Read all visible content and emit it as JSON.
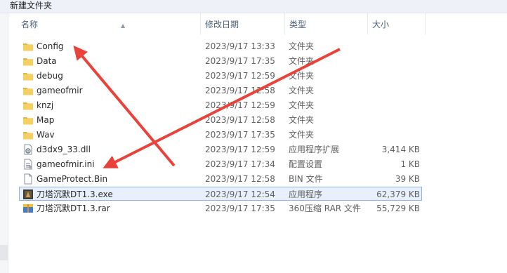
{
  "window": {
    "title": "新建文件夹"
  },
  "columns": {
    "name": "名称",
    "date": "修改日期",
    "type": "类型",
    "size": "大小"
  },
  "files": [
    {
      "name": "Config",
      "date": "2023/9/17 13:33",
      "type": "文件夹",
      "size": "",
      "icon": "folder-icon"
    },
    {
      "name": "Data",
      "date": "2023/9/17 17:35",
      "type": "文件夹",
      "size": "",
      "icon": "folder-icon"
    },
    {
      "name": "debug",
      "date": "2023/9/17 12:59",
      "type": "文件夹",
      "size": "",
      "icon": "folder-icon"
    },
    {
      "name": "gameofmir",
      "date": "2023/9/17 12:58",
      "type": "文件夹",
      "size": "",
      "icon": "folder-icon"
    },
    {
      "name": "knzj",
      "date": "2023/9/17 12:59",
      "type": "文件夹",
      "size": "",
      "icon": "folder-icon"
    },
    {
      "name": "Map",
      "date": "2023/9/17 12:58",
      "type": "文件夹",
      "size": "",
      "icon": "folder-icon"
    },
    {
      "name": "Wav",
      "date": "2023/9/17 17:35",
      "type": "文件夹",
      "size": "",
      "icon": "folder-icon"
    },
    {
      "name": "d3dx9_33.dll",
      "date": "2023/9/17 12:59",
      "type": "应用程序扩展",
      "size": "3,414 KB",
      "icon": "dll-file-icon"
    },
    {
      "name": "gameofmir.ini",
      "date": "2023/9/17 17:34",
      "type": "配置设置",
      "size": "1 KB",
      "icon": "ini-file-icon"
    },
    {
      "name": "GameProtect.Bin",
      "date": "2023/9/17 12:58",
      "type": "BIN 文件",
      "size": "39 KB",
      "icon": "blank-file-icon"
    },
    {
      "name": "刀塔沉默DT1.3.exe",
      "date": "2023/9/17 12:54",
      "type": "应用程序",
      "size": "62,379 KB",
      "icon": "exe-app-icon",
      "selected": true
    },
    {
      "name": "刀塔沉默DT1.3.rar",
      "date": "2023/9/17 17:35",
      "type": "360压缩 RAR 文件",
      "size": "55,729 KB",
      "icon": "rar-archive-icon"
    }
  ],
  "colors": {
    "folder": "#e8b43a",
    "arrow": "#e8423a",
    "selection": "#e7f0fc"
  }
}
